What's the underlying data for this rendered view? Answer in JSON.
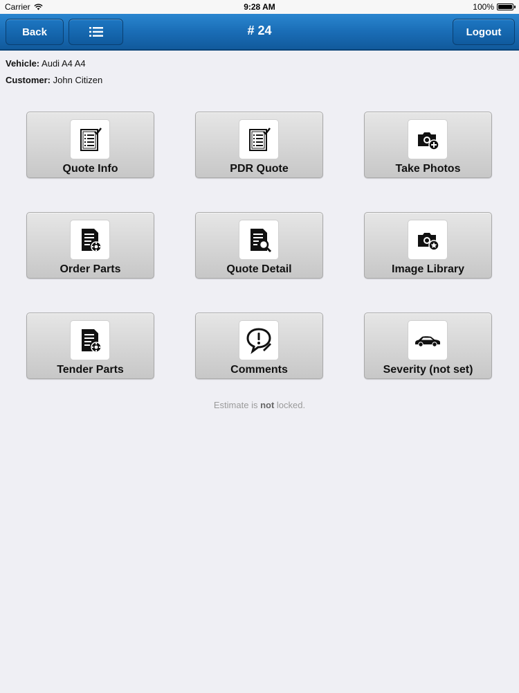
{
  "status_bar": {
    "carrier": "Carrier",
    "time": "9:28 AM",
    "battery": "100%",
    "battery_level": 1.0
  },
  "nav": {
    "back_label": "Back",
    "title": "# 24",
    "logout_label": "Logout",
    "menu_icon": "list-icon"
  },
  "info": {
    "vehicle_label": "Vehicle:",
    "vehicle_value": "Audi A4 A4",
    "customer_label": "Customer:",
    "customer_value": "John Citizen"
  },
  "tiles": [
    {
      "label": "Quote Info",
      "icon": "checklist-icon"
    },
    {
      "label": "PDR Quote",
      "icon": "checklist-icon"
    },
    {
      "label": "Take Photos",
      "icon": "camera-add-icon"
    },
    {
      "label": "Order Parts",
      "icon": "document-gear-icon"
    },
    {
      "label": "Quote Detail",
      "icon": "document-search-icon"
    },
    {
      "label": "Image Library",
      "icon": "camera-star-icon"
    },
    {
      "label": "Tender Parts",
      "icon": "document-gear-icon"
    },
    {
      "label": "Comments",
      "icon": "comment-alert-icon"
    },
    {
      "label": "Severity (not set)",
      "icon": "car-icon"
    }
  ],
  "lock_status": {
    "prefix": "Estimate is ",
    "emphasis": "not",
    "suffix": " locked."
  },
  "colors": {
    "nav_blue": "#1a6db6",
    "background": "#efeff4"
  }
}
